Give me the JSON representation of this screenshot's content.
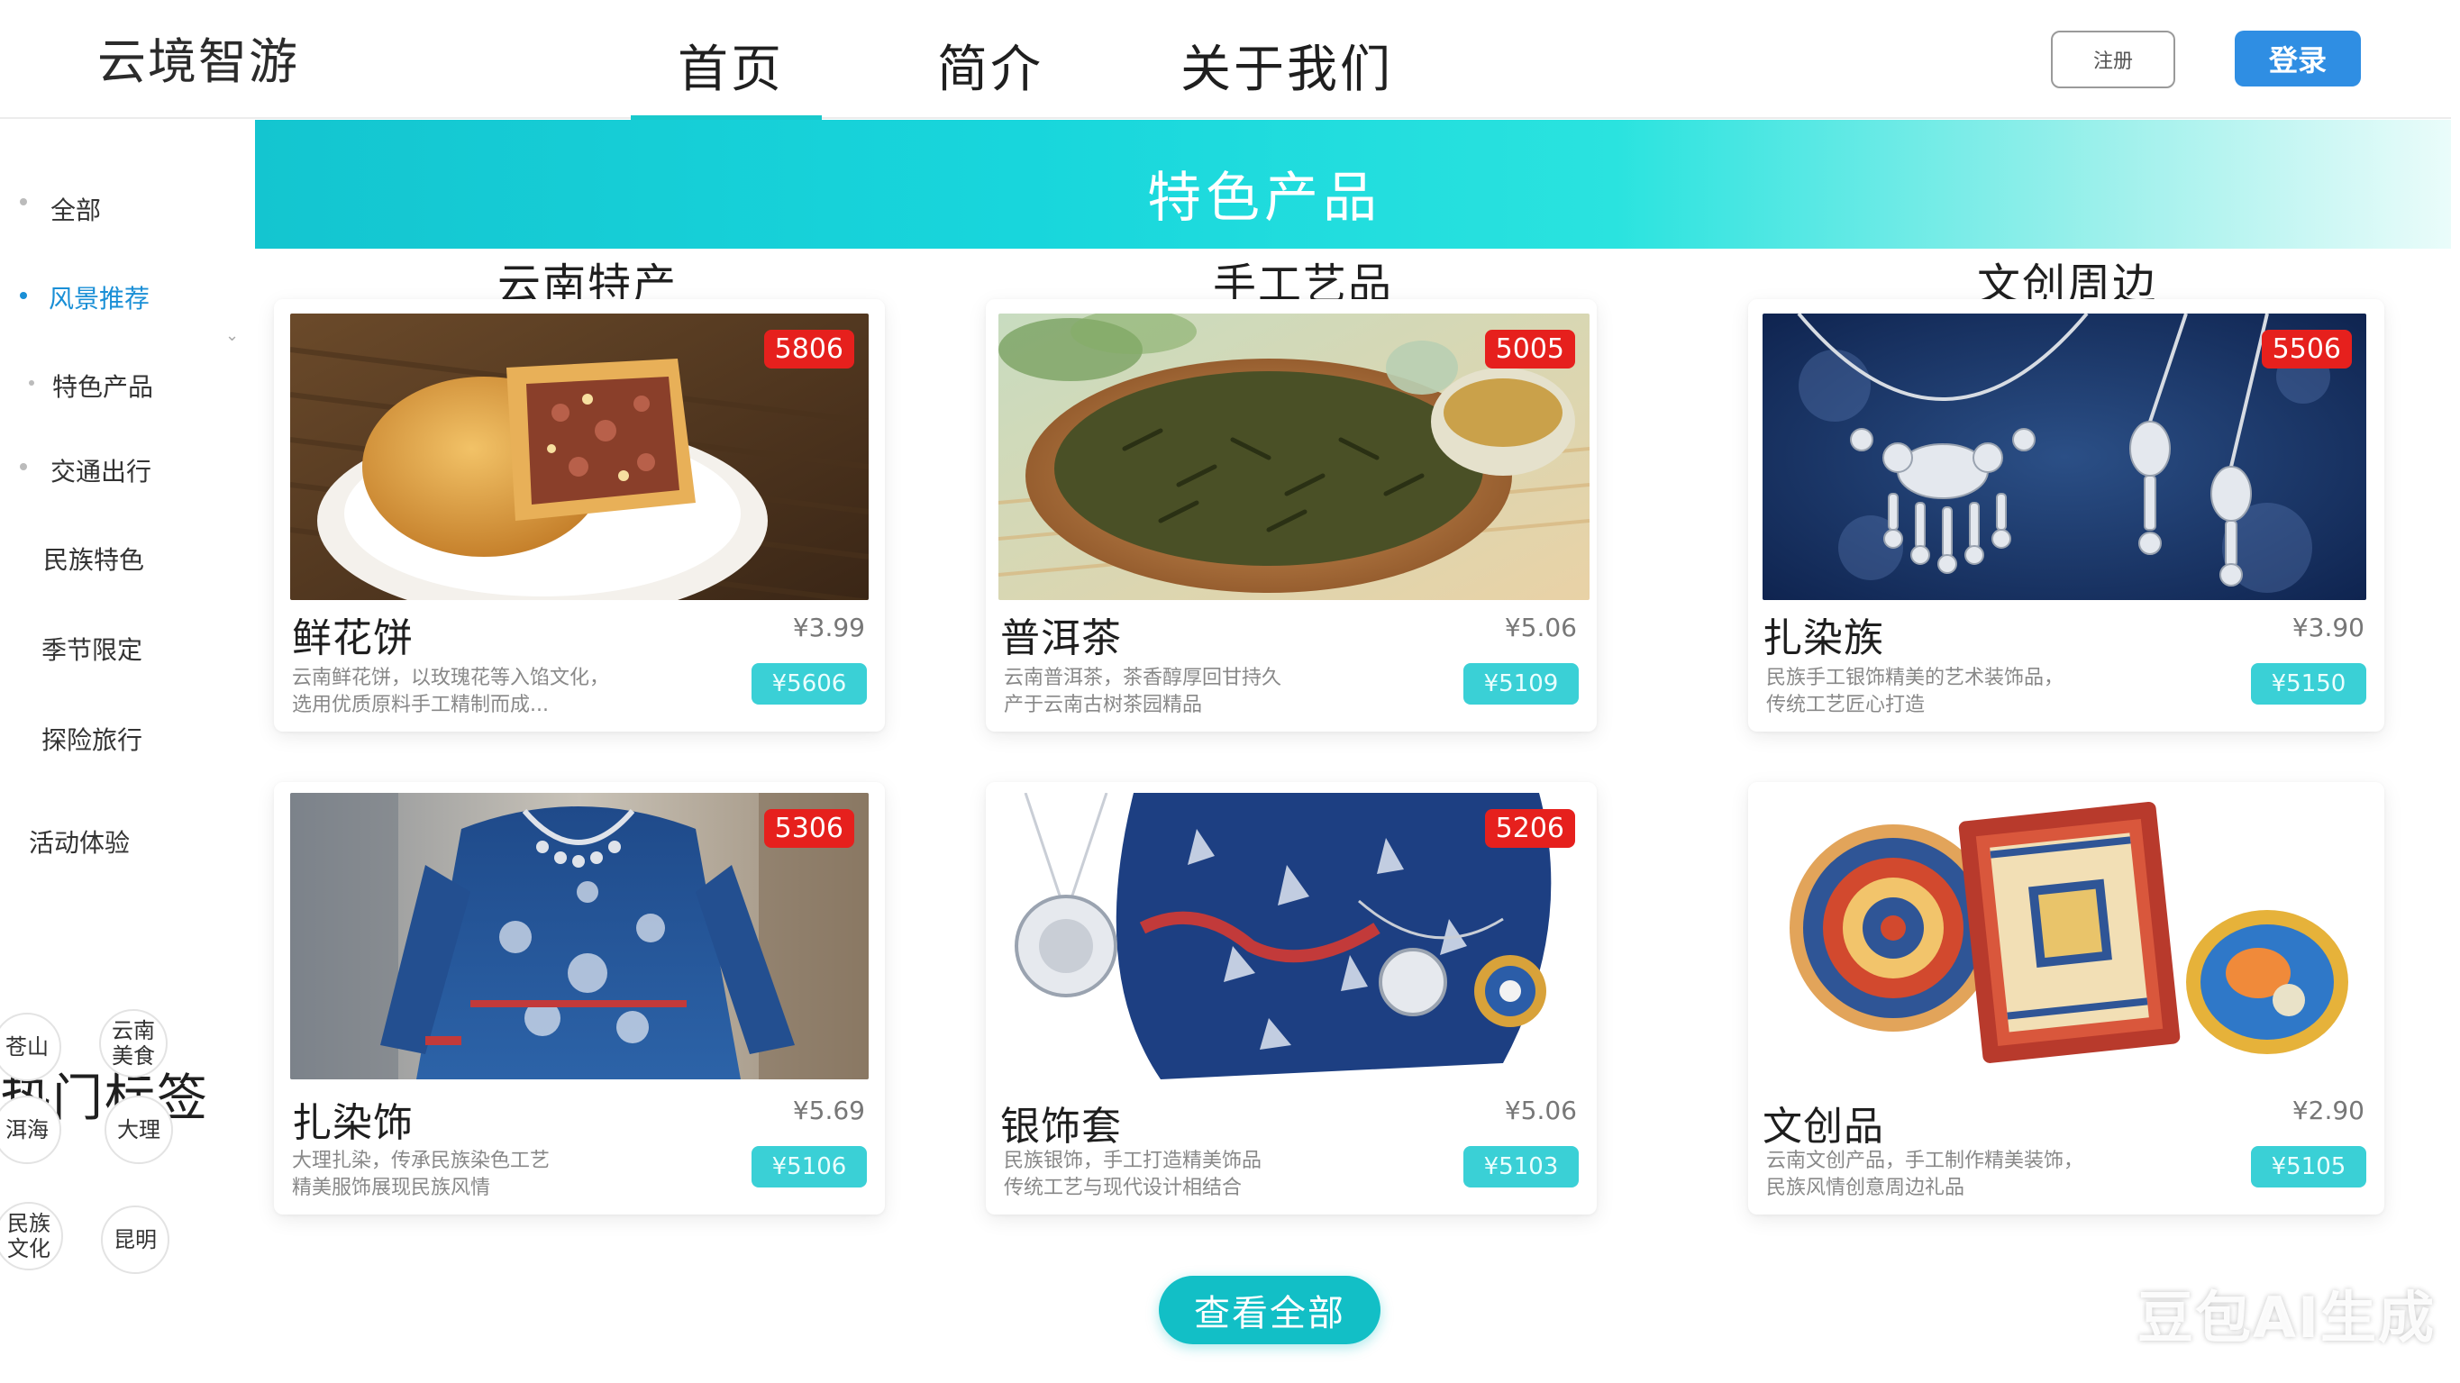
{
  "header": {
    "brand": "云境智游",
    "nav": [
      "首页",
      "简介",
      "关于我们"
    ],
    "register_label": "注册",
    "login_label": "登录"
  },
  "sidebar": {
    "items": [
      "全部",
      "风景推荐",
      "特色产品",
      "交通出行",
      "民族特色",
      "季节限定",
      "探险旅行",
      "活动体验"
    ],
    "hot_tags_title": "热门标签",
    "tags": [
      "苍山",
      "云南\n美食",
      "洱海",
      "大理",
      "民族\n文化",
      "昆明"
    ]
  },
  "banner": {
    "title": "特色产品"
  },
  "categories": [
    "云南特产",
    "手工艺品",
    "文创周边"
  ],
  "products": [
    {
      "badge": "5806",
      "name": "鲜花饼",
      "price": "¥3.99",
      "desc1": "云南鲜花饼，以玫瑰花等入馅文化，",
      "desc2": "选用优质原料手工精制而成...",
      "buy": "¥5606"
    },
    {
      "badge": "5005",
      "name": "普洱茶",
      "price": "¥5.06",
      "desc1": "云南普洱茶，茶香醇厚回甘持久",
      "desc2": "产于云南古树茶园精品",
      "buy": "¥5109"
    },
    {
      "badge": "5506",
      "name": "扎染族",
      "price": "¥3.90",
      "desc1": "民族手工银饰精美的艺术装饰品，",
      "desc2": "传统工艺匠心打造",
      "buy": "¥5150"
    },
    {
      "badge": "5306",
      "name": "扎染饰",
      "price": "¥5.69",
      "desc1": "大理扎染，传承民族染色工艺",
      "desc2": "精美服饰展现民族风情",
      "buy": "¥5106"
    },
    {
      "badge": "5206",
      "name": "银饰套",
      "price": "¥5.06",
      "desc1": "民族银饰，手工打造精美饰品",
      "desc2": "传统工艺与现代设计相结合",
      "buy": "¥5103"
    },
    {
      "badge": "",
      "name": "文创品",
      "price": "¥2.90",
      "desc1": "云南文创产品，手工制作精美装饰，",
      "desc2": "民族风情创意周边礼品",
      "buy": "¥5105"
    }
  ],
  "view_all_label": "查看全部",
  "watermark": "豆包AI生成"
}
